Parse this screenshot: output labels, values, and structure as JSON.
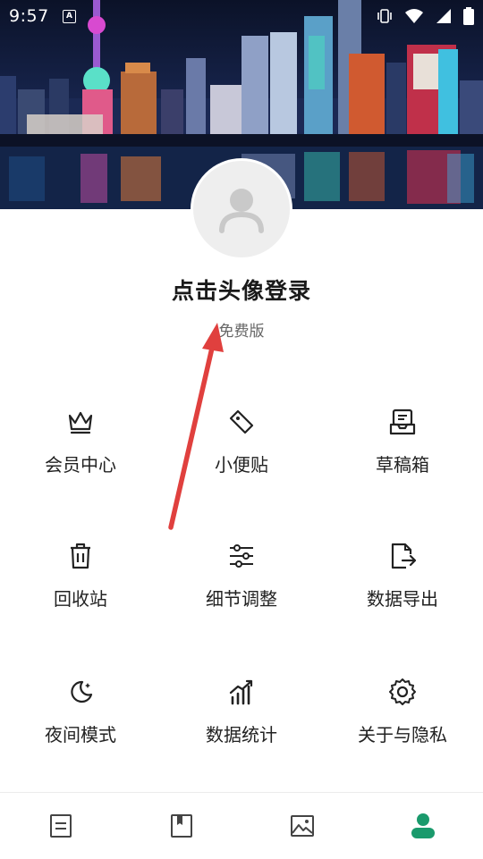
{
  "status_bar": {
    "time": "9:57",
    "notification_icon": "a-badge-icon",
    "icons": [
      "vibrate-icon",
      "wifi-icon",
      "signal-icon",
      "battery-icon"
    ]
  },
  "header": {
    "image": "city-skyline-night-photo"
  },
  "profile": {
    "avatar_icon": "default-user-icon",
    "login_prompt": "点击头像登录",
    "edition": "免费版"
  },
  "menu": {
    "items": [
      {
        "label": "会员中心",
        "icon": "crown-icon"
      },
      {
        "label": "小便贴",
        "icon": "tag-icon"
      },
      {
        "label": "草稿箱",
        "icon": "drafts-tray-icon"
      },
      {
        "label": "回收站",
        "icon": "trash-icon"
      },
      {
        "label": "细节调整",
        "icon": "sliders-icon"
      },
      {
        "label": "数据导出",
        "icon": "export-file-icon"
      },
      {
        "label": "夜间模式",
        "icon": "moon-icon"
      },
      {
        "label": "数据统计",
        "icon": "bar-chart-icon"
      },
      {
        "label": "关于与隐私",
        "icon": "gear-icon"
      }
    ]
  },
  "bottom_nav": {
    "tabs": [
      {
        "icon": "list-icon",
        "active": false
      },
      {
        "icon": "book-icon",
        "active": false
      },
      {
        "icon": "image-icon",
        "active": false
      },
      {
        "icon": "profile-icon",
        "active": true
      }
    ],
    "active_color": "#1a9a6c",
    "inactive_color": "#444444"
  },
  "annotation": {
    "arrow_color": "#e0403e"
  }
}
